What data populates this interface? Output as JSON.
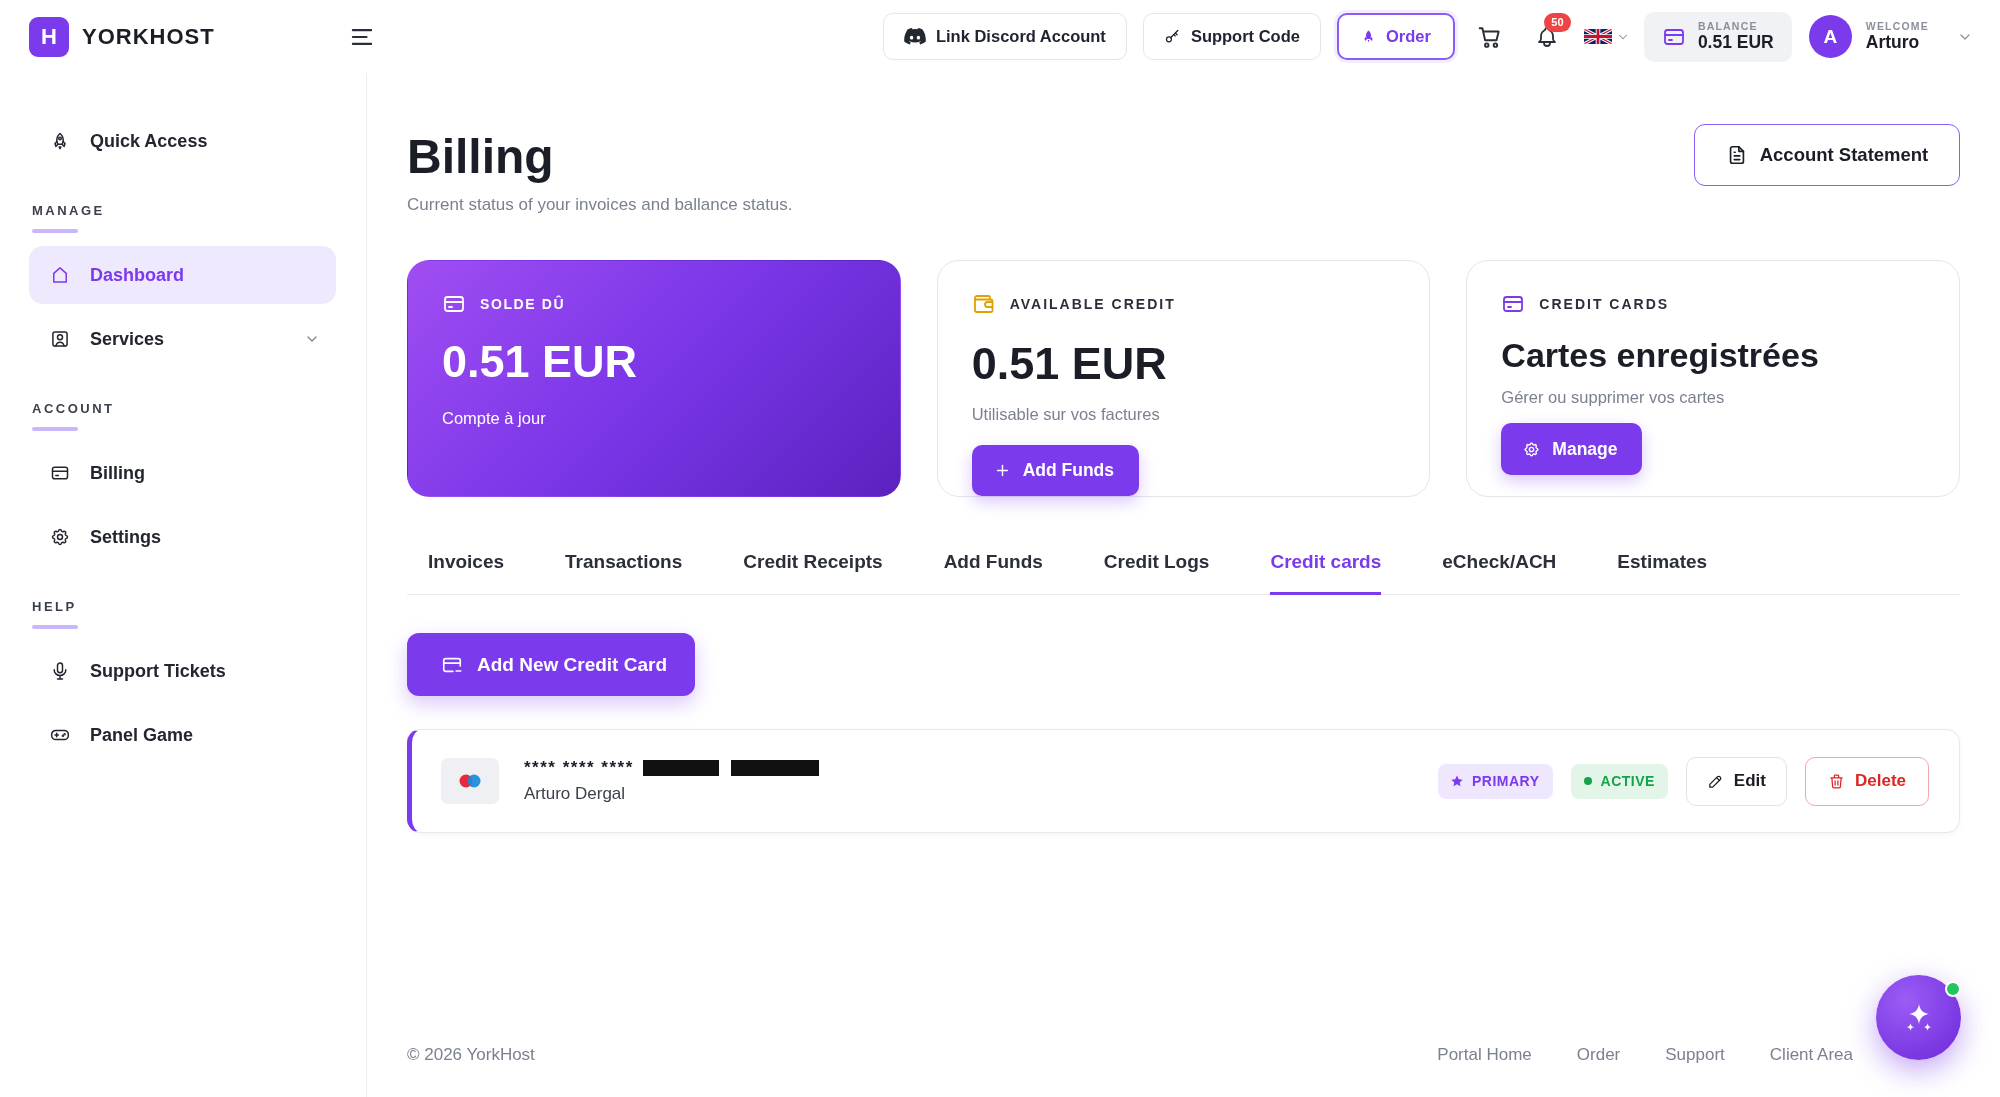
{
  "top_bar": {
    "brand": {
      "letter": "H",
      "name": "YORKHOST"
    },
    "actions": [
      {
        "label": "Link Discord Account",
        "kind": "discord"
      },
      {
        "label": "Support Code",
        "kind": "key"
      },
      {
        "label": "Order",
        "kind": "primary"
      }
    ],
    "notifications": {
      "count": "50"
    },
    "balance": {
      "label": "BALANCE",
      "value": "0.51 EUR"
    },
    "user": {
      "initial": "A",
      "greeting": "WELCOME",
      "name": "Arturo"
    }
  },
  "sidebar": {
    "quick_access": {
      "label": "Quick Access",
      "selected": false
    },
    "sections": [
      {
        "heading": "MANAGE",
        "items": [
          {
            "label": "Dashboard",
            "kind": "link",
            "selected": true
          },
          {
            "label": "Services",
            "kind": "group",
            "selected": false,
            "expanded": false
          }
        ]
      },
      {
        "heading": "ACCOUNT",
        "items": [
          {
            "label": "Billing",
            "kind": "link",
            "selected": false
          },
          {
            "label": "Settings",
            "kind": "link",
            "selected": false
          }
        ]
      },
      {
        "heading": "HELP",
        "items": [
          {
            "label": "Support Tickets",
            "kind": "link",
            "selected": false
          },
          {
            "label": "Panel Game",
            "kind": "link",
            "selected": false
          }
        ]
      }
    ]
  },
  "page": {
    "title": "Billing",
    "subtitle": "Current status of your invoices and ballance status.",
    "action": "Account Statement"
  },
  "summary_cards": [
    {
      "kind": "balance",
      "label": "SOLDE DÛ",
      "value": "0.51 EUR",
      "note": "Compte à jour"
    },
    {
      "kind": "credit",
      "label": "AVAILABLE CREDIT",
      "value": "0.51 EUR",
      "note": "Utilisable sur vos factures",
      "button": "Add Funds"
    },
    {
      "kind": "cards",
      "label": "CREDIT CARDS",
      "value": "Cartes enregistrées",
      "note": "Gérer ou supprimer vos cartes",
      "button": "Manage"
    }
  ],
  "tabs": [
    {
      "label": "Invoices",
      "selected": false
    },
    {
      "label": "Transactions",
      "selected": false
    },
    {
      "label": "Credit Receipts",
      "selected": false
    },
    {
      "label": "Add Funds",
      "selected": false
    },
    {
      "label": "Credit Logs",
      "selected": false
    },
    {
      "label": "Credit cards",
      "selected": true
    },
    {
      "label": "eCheck/ACH",
      "selected": false
    },
    {
      "label": "Estimates",
      "selected": false
    }
  ],
  "credit_cards": {
    "add_button": "Add New Credit Card",
    "cards": [
      {
        "masked_number": "**** **** ****",
        "number_redacted": true,
        "holder": "Arturo Dergal",
        "badges": [
          {
            "label": "PRIMARY",
            "kind": "star",
            "color": "#7c3aed"
          },
          {
            "label": "ACTIVE",
            "kind": "dot",
            "color": "#16a34a"
          }
        ],
        "actions": [
          {
            "label": "Edit",
            "kind": "edit"
          },
          {
            "label": "Delete",
            "kind": "delete"
          }
        ]
      }
    ]
  },
  "footer": {
    "copyright": "© 2026 YorkHost",
    "links": [
      "Portal Home",
      "Order",
      "Support",
      "Client Area"
    ]
  },
  "assistant": {
    "online": true
  }
}
